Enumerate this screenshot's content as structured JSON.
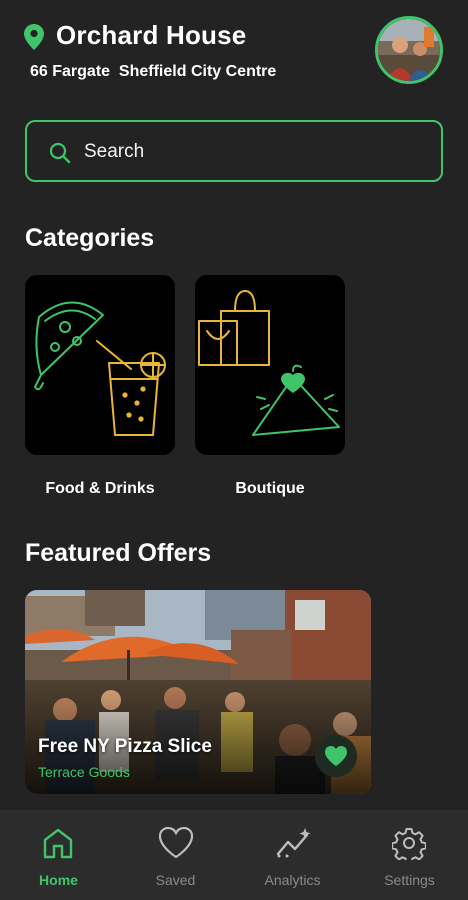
{
  "header": {
    "venue_name": "Orchard House",
    "address": "66 Fargate  Sheffield City Centre",
    "pin_icon": "location-pin-icon",
    "avatar_alt": "user avatar"
  },
  "search": {
    "label": "Search",
    "icon": "search-icon"
  },
  "categories": {
    "title": "Categories",
    "items": [
      {
        "label": "Food & Drinks",
        "icon": "pizza-drink-icon"
      },
      {
        "label": "Boutique",
        "icon": "shopping-bag-hanger-icon"
      }
    ]
  },
  "featured": {
    "title": "Featured Offers",
    "offers": [
      {
        "title": "Free NY Pizza Slice",
        "vendor": "Terrace Goods",
        "favorited": true
      }
    ]
  },
  "nav": {
    "items": [
      {
        "label": "Home",
        "icon": "home-icon",
        "active": true
      },
      {
        "label": "Saved",
        "icon": "heart-icon",
        "active": false
      },
      {
        "label": "Analytics",
        "icon": "analytics-icon",
        "active": false
      },
      {
        "label": "Settings",
        "icon": "gear-icon",
        "active": false
      }
    ]
  },
  "colors": {
    "accent_green": "#3fc46a",
    "background": "#232323",
    "card_black": "#000000",
    "icon_yellow": "#e8b634",
    "nav_background": "#2c2c2c"
  }
}
